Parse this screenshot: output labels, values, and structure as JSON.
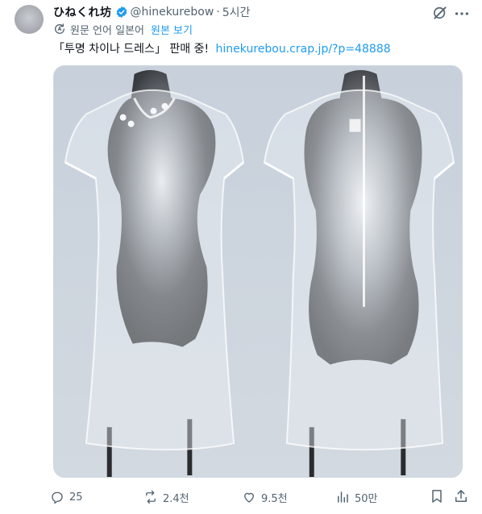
{
  "tweet": {
    "display_name": "ひねくれ坊",
    "handle": "@hinekurebow",
    "separator": "·",
    "time": "5시간",
    "translate_label": "원문 언어 일본어",
    "show_original": "원본 보기",
    "text": "「투명 차이나 드레스」 판매 중!",
    "link": "hinekurebou.crap.jp/?p=48888"
  },
  "actions": {
    "replies": "25",
    "reposts": "2.4천",
    "likes": "9.5천",
    "views": "50만"
  },
  "colors": {
    "link": "#1d9bf0",
    "secondary_text": "#536471",
    "verified": "#1d9bf0"
  },
  "icons": [
    "verified-badge-icon",
    "grok-icon",
    "more-icon",
    "translate-icon",
    "reply-icon",
    "repost-icon",
    "like-icon",
    "views-icon",
    "bookmark-icon",
    "share-icon"
  ]
}
